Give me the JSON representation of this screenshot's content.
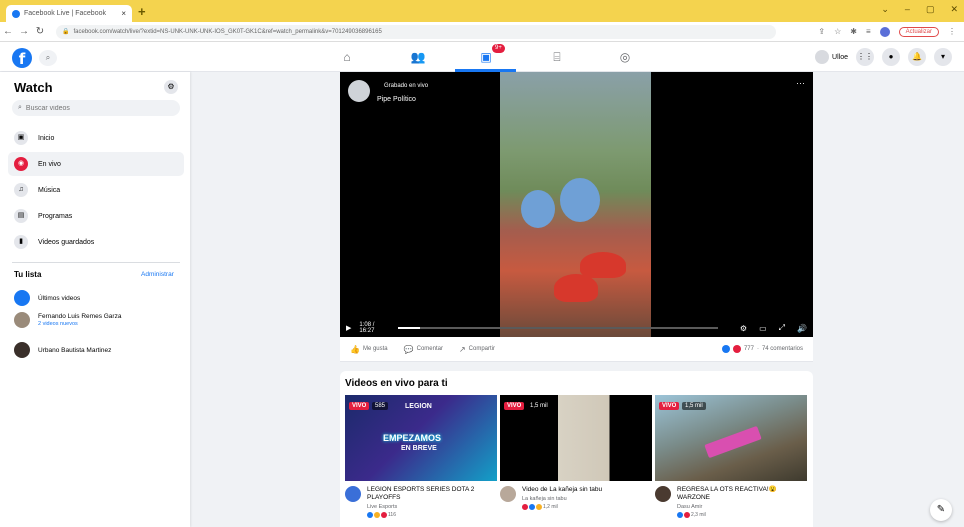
{
  "browser": {
    "tab_title": "Facebook Live | Facebook",
    "tab_close": "×",
    "new_tab": "+",
    "url": "facebook.com/watch/live/?extid=NS-UNK-UNK-UNK-IOS_GK0T-GK1C&ref=watch_permalink&v=701249036896165",
    "update_label": "Actualizar"
  },
  "header": {
    "logo": "f",
    "watch_badge": "9+",
    "user_name": "Ulloe"
  },
  "sidebar": {
    "title": "Watch",
    "search_placeholder": "Buscar videos",
    "items": [
      {
        "label": "Inicio",
        "icon": "home-icon"
      },
      {
        "label": "En vivo",
        "icon": "live-icon"
      },
      {
        "label": "Música",
        "icon": "music-icon"
      },
      {
        "label": "Programas",
        "icon": "shows-icon"
      },
      {
        "label": "Videos guardados",
        "icon": "saved-icon"
      }
    ],
    "list_title": "Tu lista",
    "admin_link": "Administrar",
    "list": [
      {
        "name": "Últimos videos",
        "sub": ""
      },
      {
        "name": "Fernando Luis Remes Garza",
        "sub": "2 videos nuevos"
      },
      {
        "name": "Urbano Bautista Martinez",
        "sub": ""
      }
    ]
  },
  "video": {
    "recorded_label": "Grabado en vivo",
    "channel": "Pipe Político",
    "time": "1:08 / 16:27",
    "progress": 0.07
  },
  "actions": {
    "like": "Me gusta",
    "comment": "Comentar",
    "share": "Compartir",
    "reaction_count": "777",
    "comments": "74 comentarios"
  },
  "live": {
    "title": "Videos en vivo para ti",
    "live_label": "VIVO",
    "cards": [
      {
        "viewers": "585",
        "title": "LEGION ESPORTS SERIES DOTA 2 PLAYOFFS",
        "sub": "Live Esports",
        "reacts": "116",
        "thumb_text": "LEGION",
        "thumb_text2": "EMPEZAMOS",
        "thumb_text3": "EN BREVE"
      },
      {
        "viewers": "1,5 mil",
        "title": "Video de La kañeja sin tabu",
        "sub": "La kañeja sin tabu",
        "reacts": "1,2 mil"
      },
      {
        "viewers": "1,5 mil",
        "title": "REGRESA LA OTS REACTIVA!😮 WARZONE",
        "sub": "Dasu Amir",
        "reacts": "2,3 mil"
      }
    ]
  },
  "colors": {
    "brand": "#1877f2",
    "live_red": "#e41e3f",
    "browser_bar": "#f4d34e"
  }
}
